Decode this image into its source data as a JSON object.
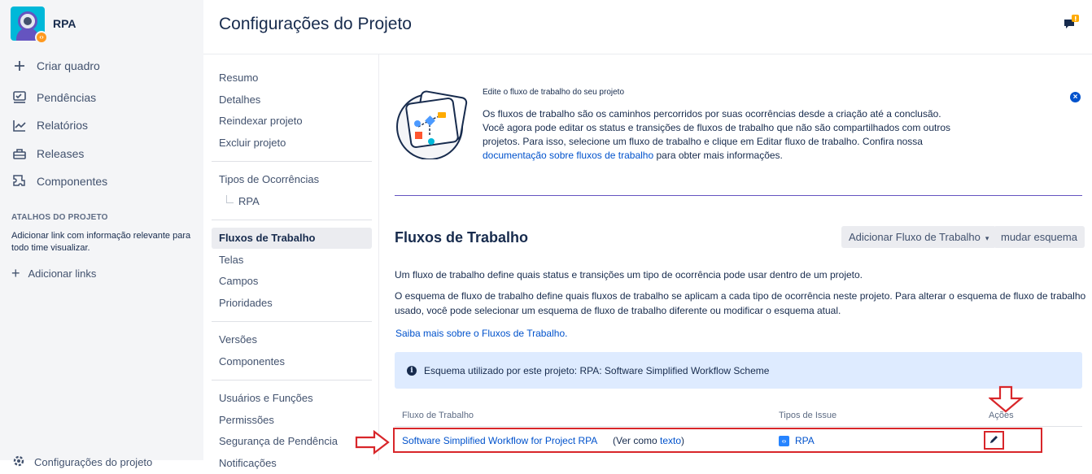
{
  "sidebar": {
    "project_name": "RPA",
    "nav": [
      {
        "label": "Criar quadro",
        "icon": "plus-icon"
      },
      {
        "label": "Pendências",
        "icon": "backlog-icon"
      },
      {
        "label": "Relatórios",
        "icon": "reports-icon"
      },
      {
        "label": "Releases",
        "icon": "ship-icon"
      },
      {
        "label": "Componentes",
        "icon": "component-icon"
      }
    ],
    "shortcuts_title": "ATALHOS DO PROJETO",
    "shortcuts_desc": "Adicionar link com informação relevante para todo time visualizar.",
    "add_links": "Adicionar links",
    "footer_label": "Configurações do projeto"
  },
  "page": {
    "title": "Configurações do Projeto"
  },
  "settings_nav": {
    "group1": [
      "Resumo",
      "Detalhes",
      "Reindexar projeto",
      "Excluir projeto"
    ],
    "issue_types": "Tipos de Ocorrências",
    "issue_types_sub": "RPA",
    "group3": [
      "Fluxos de Trabalho",
      "Telas",
      "Campos",
      "Prioridades"
    ],
    "group4": [
      "Versões",
      "Componentes"
    ],
    "group5": [
      "Usuários e Funções",
      "Permissões",
      "Segurança de Pendência",
      "Notificações"
    ]
  },
  "banner": {
    "title": "Edite o fluxo de trabalho do seu projeto",
    "text_before": "Os fluxos de trabalho são os caminhos percorridos por suas ocorrências desde a criação até a conclusão. Você agora pode editar os status e transições de fluxos de trabalho que não são compartilhados com outros projetos. Para isso, selecione um fluxo de trabalho e clique em Editar fluxo de trabalho. Confira nossa ",
    "link": "documentação sobre fluxos de trabalho",
    "text_after": " para obter mais informações."
  },
  "workflows": {
    "title": "Fluxos de Trabalho",
    "add_button": "Adicionar Fluxo de Trabalho",
    "change_scheme_button": "mudar esquema",
    "desc1": "Um fluxo de trabalho define quais status e transições um tipo de ocorrência pode usar dentro de um projeto.",
    "desc2": "O esquema de fluxo de trabalho define quais fluxos de trabalho se aplicam a cada tipo de ocorrência neste projeto. Para alterar o esquema de fluxo de trabalho usado, você pode selecionar um esquema de fluxo de trabalho diferente ou modificar o esquema atual.",
    "learn_more": "Saiba mais sobre o Fluxos de Trabalho.",
    "scheme_info": "Esquema utilizado por este projeto: RPA: Software Simplified Workflow Scheme",
    "columns": [
      "Fluxo de Trabalho",
      "Tipos de Issue",
      "Ações"
    ],
    "rows": [
      {
        "name": "Software Simplified Workflow for Project RPA",
        "view_prefix": "(Ver como ",
        "view_link": "texto",
        "view_suffix": ")",
        "issue_type": "RPA"
      }
    ]
  },
  "colors": {
    "accent": "#0052cc",
    "highlight_red": "#d8262a",
    "info_bg": "#deebff"
  }
}
